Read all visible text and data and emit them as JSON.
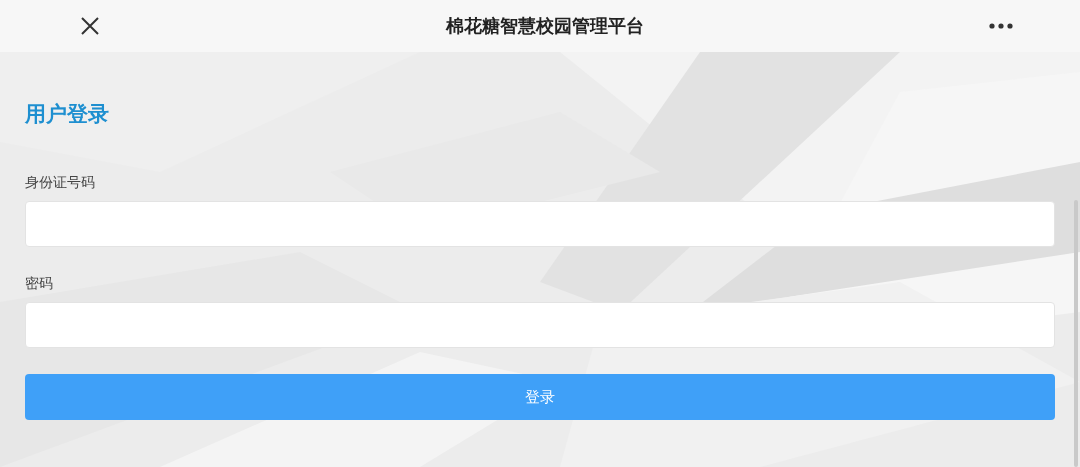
{
  "window": {
    "title": "棉花糖智慧校园管理平台"
  },
  "form": {
    "heading": "用户登录",
    "fields": [
      {
        "label": "身份证号码"
      },
      {
        "label": "密码"
      }
    ],
    "submit": "登录"
  }
}
